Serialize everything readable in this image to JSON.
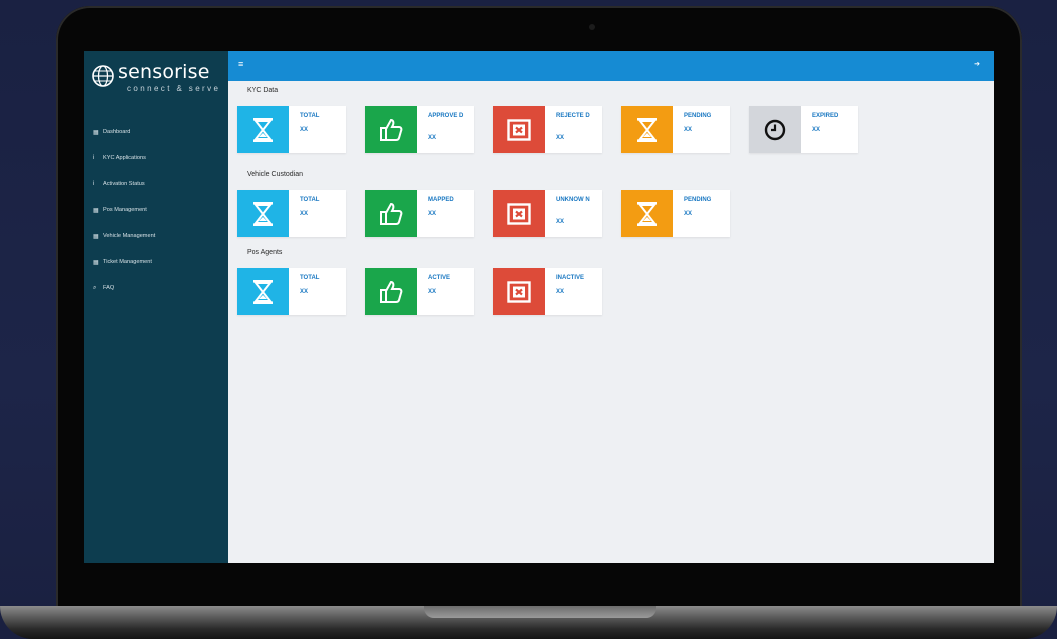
{
  "sidebar": {
    "logo_name": "sensorise",
    "logo_tagline": "connect & serve",
    "items": [
      {
        "icon": "calendar-icon",
        "label": "Dashboard"
      },
      {
        "icon": "info-icon",
        "label": "KYC Applications"
      },
      {
        "icon": "info-icon",
        "label": "Activation Status"
      },
      {
        "icon": "calendar-icon",
        "label": "Pos Management"
      },
      {
        "icon": "calendar-icon",
        "label": "Vehicle Management"
      },
      {
        "icon": "calendar-icon",
        "label": "Ticket Management"
      },
      {
        "icon": "search-icon",
        "label": "FAQ"
      }
    ]
  },
  "topbar": {
    "menu_icon": "hamburger-icon",
    "exit_icon": "sign-out-icon"
  },
  "sections": {
    "kyc": {
      "title": "KYC Data",
      "cards": [
        {
          "label": "TOTAL",
          "value": "XX",
          "icon": "hourglass-icon",
          "color": "#1fb4e6"
        },
        {
          "label": "APPROVE D",
          "value": "XX",
          "icon": "thumbs-up-icon",
          "color": "#1aa64b"
        },
        {
          "label": "REJECTE D",
          "value": "XX",
          "icon": "close-box-icon",
          "color": "#dd4b39"
        },
        {
          "label": "PENDING",
          "value": "XX",
          "icon": "hourglass-icon",
          "color": "#f39c12"
        },
        {
          "label": "EXPIRED",
          "value": "XX",
          "icon": "clock-icon",
          "color": "#d3d6db"
        }
      ]
    },
    "vehicle": {
      "title": "Vehicle Custodian",
      "cards": [
        {
          "label": "TOTAL",
          "value": "XX",
          "icon": "hourglass-icon",
          "color": "#1fb4e6"
        },
        {
          "label": "MAPPED",
          "value": "XX",
          "icon": "thumbs-up-icon",
          "color": "#1aa64b"
        },
        {
          "label": "UNKNOW N",
          "value": "XX",
          "icon": "close-box-icon",
          "color": "#dd4b39"
        },
        {
          "label": "PENDING",
          "value": "XX",
          "icon": "hourglass-icon",
          "color": "#f39c12"
        }
      ]
    },
    "pos": {
      "title": "Pos Agents",
      "cards": [
        {
          "label": "TOTAL",
          "value": "XX",
          "icon": "hourglass-icon",
          "color": "#1fb4e6"
        },
        {
          "label": "ACTIVE",
          "value": "XX",
          "icon": "thumbs-up-icon",
          "color": "#1aa64b"
        },
        {
          "label": "INACTIVE",
          "value": "XX",
          "icon": "close-box-icon",
          "color": "#dd4b39"
        }
      ]
    }
  }
}
